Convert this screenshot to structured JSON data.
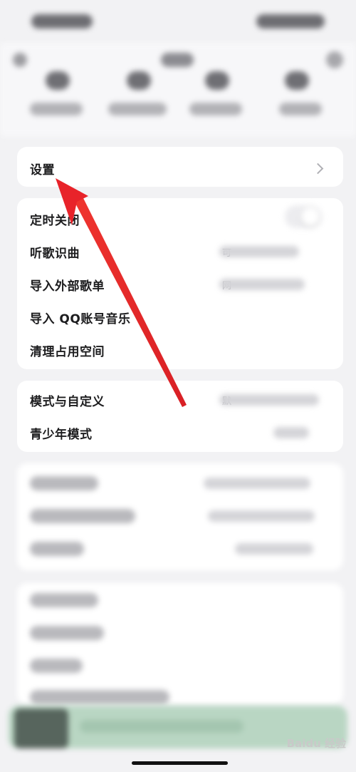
{
  "colors": {
    "arrow": "#e8232a",
    "background": "#f2f2f4",
    "card": "#ffffff",
    "player": "#b9d6c3"
  },
  "settings_row": {
    "label": "设置",
    "icon": "chevron-right-icon"
  },
  "group1": [
    {
      "id": "timer",
      "label": "定时关闭",
      "value": ""
    },
    {
      "id": "recognize",
      "label": "听歌识曲",
      "value": "可"
    },
    {
      "id": "import-playlist",
      "label": "导入外部歌单",
      "value": "网"
    },
    {
      "id": "import-qq",
      "label": "导入 QQ账号音乐",
      "value": ""
    },
    {
      "id": "clean-storage",
      "label": "清理占用空间",
      "value": ""
    }
  ],
  "group2": [
    {
      "id": "mode-custom",
      "label": "模式与自定义",
      "value": "默"
    },
    {
      "id": "teen-mode",
      "label": "青少年模式",
      "value": ""
    }
  ],
  "watermark": "Baidu 经验"
}
